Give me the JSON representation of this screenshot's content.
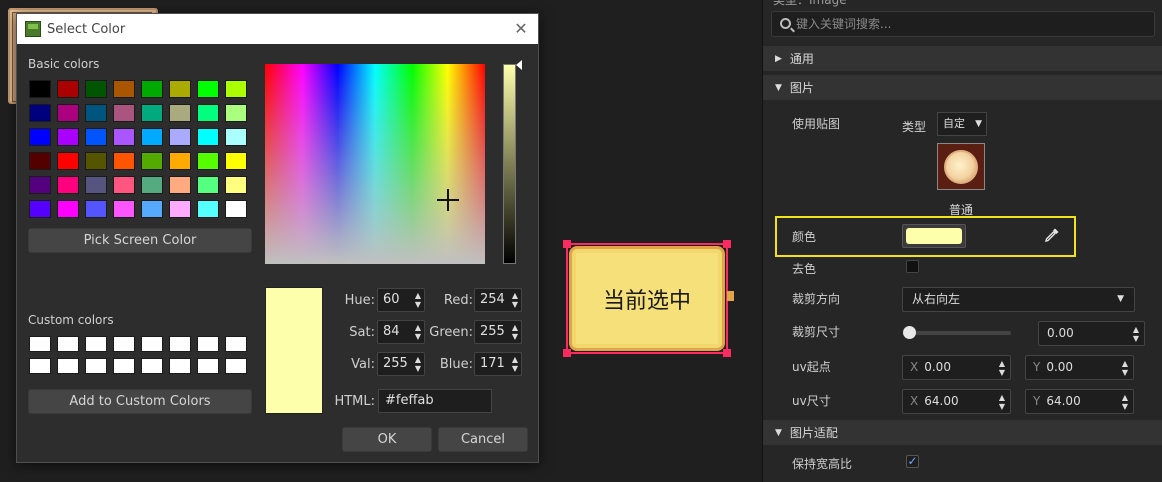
{
  "preview": {
    "label": "当前选中"
  },
  "dialog": {
    "title": "Select Color",
    "basic_label": "Basic colors",
    "custom_label": "Custom colors",
    "pick_label": "Pick Screen Color",
    "add_custom_label": "Add to Custom Colors",
    "ok_label": "OK",
    "cancel_label": "Cancel",
    "basic_colors": [
      "#000000",
      "#aa0000",
      "#005500",
      "#aa5500",
      "#00aa00",
      "#aaaa00",
      "#00ff00",
      "#aaff00",
      "#00007f",
      "#aa007f",
      "#00557f",
      "#aa557f",
      "#00aa7f",
      "#aaaa7f",
      "#00ff7f",
      "#aaff7f",
      "#0000ff",
      "#aa00ff",
      "#0055ff",
      "#aa55ff",
      "#00aaff",
      "#aaaaff",
      "#00ffff",
      "#aaffff",
      "#550000",
      "#ff0000",
      "#555500",
      "#ff5500",
      "#55aa00",
      "#ffaa00",
      "#55ff00",
      "#ffff00",
      "#55007f",
      "#ff007f",
      "#55557f",
      "#ff557f",
      "#55aa7f",
      "#ffaa7f",
      "#55ff7f",
      "#ffff7f",
      "#5500ff",
      "#ff00ff",
      "#5555ff",
      "#ff55ff",
      "#55aaff",
      "#ffaaff",
      "#55ffff",
      "#ffffff"
    ],
    "fields": {
      "hue_label": "Hue:",
      "hue": "60",
      "sat_label": "Sat:",
      "sat": "84",
      "val_label": "Val:",
      "val": "255",
      "red_label": "Red:",
      "red": "254",
      "green_label": "Green:",
      "green": "255",
      "blue_label": "Blue:",
      "blue": "171",
      "html_label": "HTML:",
      "html": "#feffab"
    },
    "current_color": "#feffab"
  },
  "panel": {
    "title_fragment": "类型：Image",
    "search_placeholder": "键入关键词搜索...",
    "sections": {
      "general": "通用",
      "image": "图片",
      "fit": "图片适配"
    },
    "use_texture_label": "使用贴图",
    "type_label": "类型",
    "type_value": "自定",
    "texture_name": "普通",
    "color_label": "颜色",
    "color_value": "#feffab",
    "decolor_label": "去色",
    "clip_dir_label": "裁剪方向",
    "clip_dir_value": "从右向左",
    "clip_size_label": "裁剪尺寸",
    "clip_size_value": "0.00",
    "clip_size_fraction": 0.0,
    "uv_origin_label": "uv起点",
    "uv_origin_x": "0.00",
    "uv_origin_y": "0.00",
    "uv_size_label": "uv尺寸",
    "uv_size_x": "64.00",
    "uv_size_y": "64.00",
    "axis_x": "X",
    "axis_y": "Y",
    "keep_ratio_label": "保持宽高比"
  }
}
